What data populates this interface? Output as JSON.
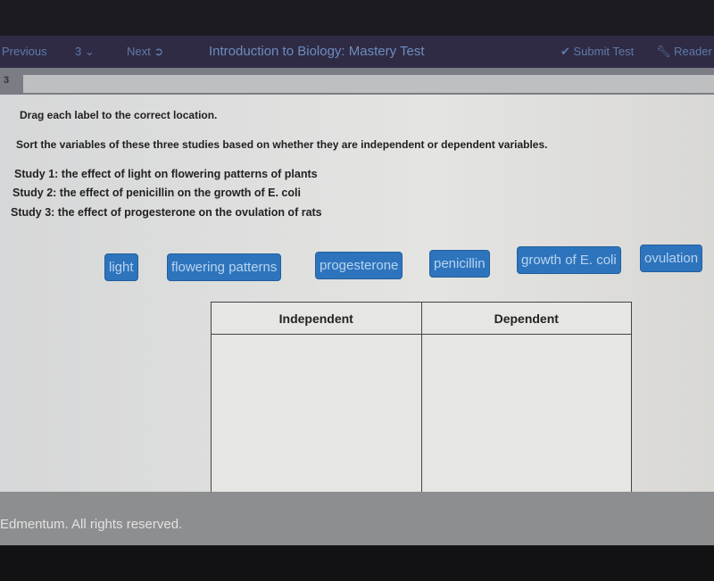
{
  "nav": {
    "previous": "Previous",
    "question_select": "3",
    "next": "Next",
    "title": "Introduction to Biology: Mastery Test",
    "submit": "Submit Test",
    "reader": "Reader"
  },
  "question": {
    "number": "3",
    "instruction": "Drag each label to the correct location.",
    "prompt": "Sort the variables of these three studies based on whether they are independent or dependent variables.",
    "studies": [
      "Study 1: the effect of light on flowering patterns of plants",
      "Study 2: the effect of penicillin on the growth of E. coli",
      "Study 3: the effect of progesterone on the ovulation of rats"
    ]
  },
  "labels": [
    "light",
    "flowering patterns",
    "progesterone",
    "penicillin",
    "growth of E. coli",
    "ovulation"
  ],
  "table": {
    "headers": [
      "Independent",
      "Dependent"
    ]
  },
  "footer": "Edmentum. All rights reserved.",
  "colors": {
    "label_bg": "#2d74bd",
    "nav_bg": "#2f2b45"
  }
}
